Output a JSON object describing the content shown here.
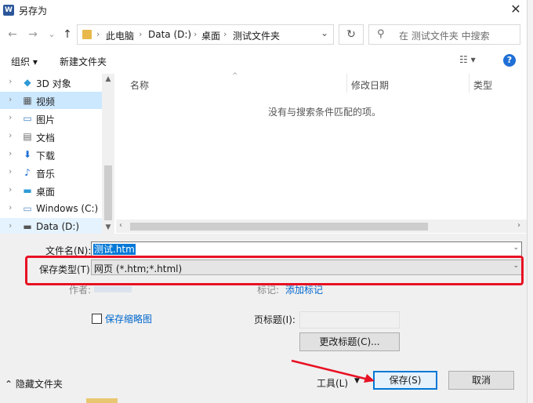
{
  "window": {
    "title": "另存为",
    "app_icon_text": "W",
    "close_glyph": "✕"
  },
  "nav_buttons": {
    "back": "←",
    "forward": "→",
    "recent": "⌄",
    "up": "↑"
  },
  "address": {
    "items": [
      "此电脑",
      "Data (D:)",
      "桌面",
      "测试文件夹"
    ],
    "separator": "›",
    "dropdown": "⌄"
  },
  "refresh_glyph": "↻",
  "search": {
    "placeholder": "在 测试文件夹 中搜索",
    "icon": "⚲"
  },
  "toolbar": {
    "organize": "组织 ▾",
    "new_folder": "新建文件夹",
    "view": "☷ ▾",
    "help": "?"
  },
  "nav_tree": [
    {
      "label": "3D 对象",
      "icon": "cube-icon",
      "glyph": "◆",
      "color": "#2e9bd6",
      "state": ""
    },
    {
      "label": "视频",
      "icon": "video-icon",
      "glyph": "▦",
      "color": "#555555",
      "state": "selected"
    },
    {
      "label": "图片",
      "icon": "picture-icon",
      "glyph": "▭",
      "color": "#3a7fc1",
      "state": ""
    },
    {
      "label": "文档",
      "icon": "document-icon",
      "glyph": "▤",
      "color": "#6a6a6a",
      "state": ""
    },
    {
      "label": "下载",
      "icon": "download-icon",
      "glyph": "⬇",
      "color": "#1f6fd6",
      "state": ""
    },
    {
      "label": "音乐",
      "icon": "music-icon",
      "glyph": "♪",
      "color": "#1f6fd6",
      "state": ""
    },
    {
      "label": "桌面",
      "icon": "desktop-icon",
      "glyph": "▬",
      "color": "#2e9bd6",
      "state": ""
    },
    {
      "label": "Windows (C:)",
      "icon": "drive-c-icon",
      "glyph": "▭",
      "color": "#5a8fc9",
      "state": ""
    },
    {
      "label": "Data (D:)",
      "icon": "drive-d-icon",
      "glyph": "▬",
      "color": "#555555",
      "state": "hover"
    }
  ],
  "file_list": {
    "columns": [
      "名称",
      "修改日期",
      "类型"
    ],
    "empty_message": "没有与搜索条件匹配的项。"
  },
  "form": {
    "filename_label": "文件名(N):",
    "filename_value": "测试.htm",
    "filetype_label": "保存类型(T):",
    "filetype_value": "网页 (*.htm;*.html)",
    "author_label": "作者:",
    "tags_label": "标记:",
    "tags_link": "添加标记",
    "thumbnail_label": "保存缩略图",
    "page_title_label": "页标题(I):",
    "change_title_button": "更改标题(C)..."
  },
  "footer": {
    "hide_folders": "隐藏文件夹",
    "tools_label": "工具(L)",
    "save_button": "保存(S)",
    "cancel_button": "取消"
  },
  "colors": {
    "accent": "#0078d7",
    "highlight_frame": "#e81123",
    "selection": "#cce8ff"
  }
}
